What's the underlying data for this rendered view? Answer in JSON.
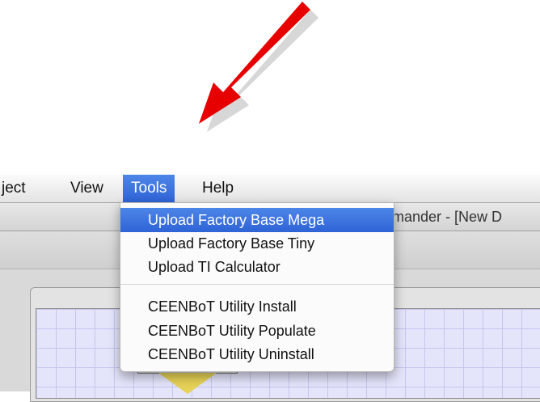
{
  "menubar": {
    "items": [
      {
        "label": "ject"
      },
      {
        "label": "View"
      },
      {
        "label": "Tools"
      },
      {
        "label": "Help"
      }
    ]
  },
  "window": {
    "title": "mmander - [New D"
  },
  "tools_menu": {
    "items": [
      {
        "label": "Upload Factory Base Mega",
        "highlighted": true
      },
      {
        "label": "Upload Factory Base Tiny"
      },
      {
        "label": "Upload TI Calculator"
      },
      {
        "label": "CEENBoT Utility Install"
      },
      {
        "label": "CEENBoT Utility Populate"
      },
      {
        "label": "CEENBoT Utility Uninstall"
      }
    ]
  },
  "colors": {
    "arrow": "#e60000",
    "highlight": "#3a6fde",
    "grid": "#e4e5fb",
    "block_triangle": "#e6d257"
  }
}
